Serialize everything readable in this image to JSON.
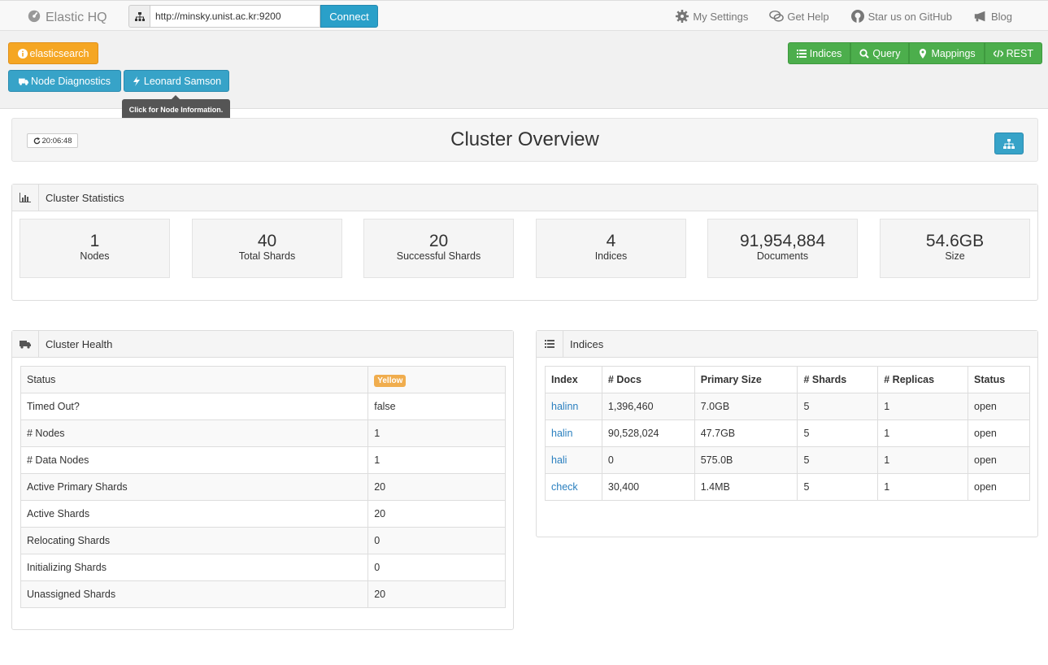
{
  "nav": {
    "brand": "Elastic HQ",
    "address_value": "http://minsky.unist.ac.kr:9200",
    "connect_label": "Connect",
    "links": [
      "My Settings",
      "Get Help",
      "Star us on GitHub",
      "Blog"
    ]
  },
  "toolbar": {
    "es_label": "elasticsearch",
    "diagnostics_label": "Node Diagnostics",
    "node_label": "Leonard Samson",
    "tooltip": "Click for Node Information.",
    "right_buttons": [
      "Indices",
      "Query",
      "Mappings",
      "REST"
    ]
  },
  "overview": {
    "refresh_time": "20:06:48",
    "title": "Cluster Overview"
  },
  "stats": {
    "title": "Cluster Statistics",
    "items": [
      {
        "value": "1",
        "label": "Nodes"
      },
      {
        "value": "40",
        "label": "Total Shards"
      },
      {
        "value": "20",
        "label": "Successful Shards"
      },
      {
        "value": "4",
        "label": "Indices"
      },
      {
        "value": "91,954,884",
        "label": "Documents"
      },
      {
        "value": "54.6GB",
        "label": "Size"
      }
    ]
  },
  "health": {
    "title": "Cluster Health",
    "status_label": "Status",
    "status_value": "Yellow",
    "status_color": "#f0ad4e",
    "rows": [
      {
        "k": "Timed Out?",
        "v": "false"
      },
      {
        "k": "# Nodes",
        "v": "1"
      },
      {
        "k": "# Data Nodes",
        "v": "1"
      },
      {
        "k": "Active Primary Shards",
        "v": "20"
      },
      {
        "k": "Active Shards",
        "v": "20"
      },
      {
        "k": "Relocating Shards",
        "v": "0"
      },
      {
        "k": "Initializing Shards",
        "v": "0"
      },
      {
        "k": "Unassigned Shards",
        "v": "20"
      }
    ]
  },
  "indices": {
    "title": "Indices",
    "headers": [
      "Index",
      "# Docs",
      "Primary Size",
      "# Shards",
      "# Replicas",
      "Status"
    ],
    "rows": [
      [
        "halinn",
        "1,396,460",
        "7.0GB",
        "5",
        "1",
        "open"
      ],
      [
        "halin",
        "90,528,024",
        "47.7GB",
        "5",
        "1",
        "open"
      ],
      [
        "hali",
        "0",
        "575.0B",
        "5",
        "1",
        "open"
      ],
      [
        "check",
        "30,400",
        "1.4MB",
        "5",
        "1",
        "open"
      ]
    ]
  }
}
